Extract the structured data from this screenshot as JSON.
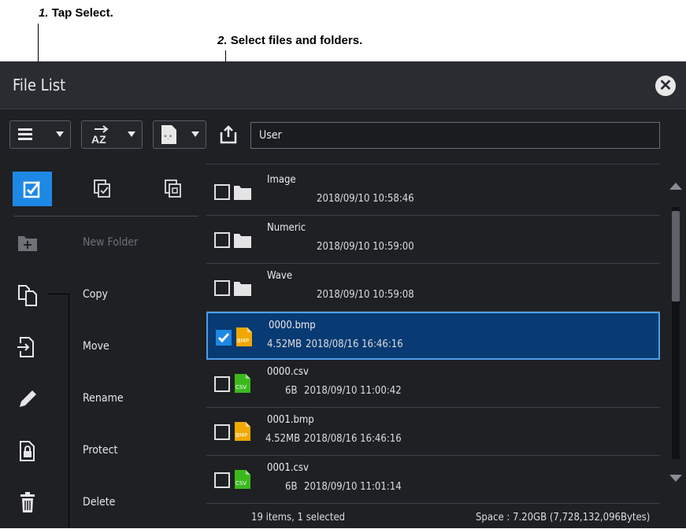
{
  "callouts": {
    "step1_num": "1.",
    "step1_text": "Tap Select.",
    "step2_num": "2.",
    "step2_text": "Select files and folders."
  },
  "window": {
    "title": "File List",
    "close_icon": "close-icon"
  },
  "toolbar": {
    "view_icon": "list-view-icon",
    "sort_icon": "sort-az-icon",
    "filter_icon": "file-type-icon",
    "up_icon": "folder-up-icon",
    "path_value": "User"
  },
  "select_tabs": [
    {
      "icon": "select-checkbox-icon",
      "active": true
    },
    {
      "icon": "select-all-icon",
      "active": false
    },
    {
      "icon": "deselect-all-icon",
      "active": false
    }
  ],
  "actions": [
    {
      "label": "New Folder",
      "icon": "new-folder-icon",
      "enabled": false
    },
    {
      "label": "Copy",
      "icon": "copy-icon",
      "enabled": true
    },
    {
      "label": "Move",
      "icon": "move-icon",
      "enabled": true
    },
    {
      "label": "Rename",
      "icon": "pencil-icon",
      "enabled": true
    },
    {
      "label": "Protect",
      "icon": "lock-icon",
      "enabled": true
    },
    {
      "label": "Delete",
      "icon": "trash-icon",
      "enabled": true
    }
  ],
  "files": [
    {
      "name": "Image",
      "size": "",
      "date": "2018/09/10 10:58:46",
      "type": "folder",
      "checked": false
    },
    {
      "name": "Numeric",
      "size": "",
      "date": "2018/09/10 10:59:00",
      "type": "folder",
      "checked": false
    },
    {
      "name": "Wave",
      "size": "",
      "date": "2018/09/10 10:59:08",
      "type": "folder",
      "checked": false
    },
    {
      "name": "0000.bmp",
      "size": "4.52MB",
      "date": "2018/08/16 16:46:16",
      "type": "bmp",
      "checked": true
    },
    {
      "name": "0000.csv",
      "size": "6B",
      "date": "2018/09/10 11:00:42",
      "type": "csv",
      "checked": false
    },
    {
      "name": "0001.bmp",
      "size": "4.52MB",
      "date": "2018/08/16 16:46:16",
      "type": "bmp",
      "checked": false
    },
    {
      "name": "0001.csv",
      "size": "6B",
      "date": "2018/09/10 11:01:14",
      "type": "csv",
      "checked": false
    }
  ],
  "file_icon_labels": {
    "bmp": "BMP",
    "csv": "CSV"
  },
  "status": {
    "count": "19 items, 1 selected",
    "space": "Space : 7.20GB (7,728,132,096Bytes)"
  },
  "colors": {
    "accent": "#1e88e5",
    "selected_row": "#083a73",
    "bmp_icon": "#f0a800",
    "csv_icon": "#3cb81e",
    "background": "#1e2024"
  }
}
